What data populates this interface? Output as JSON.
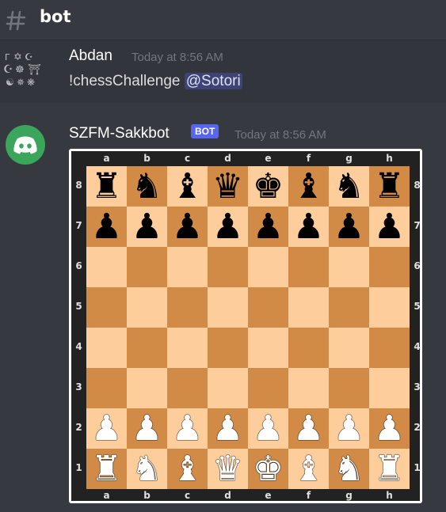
{
  "channel": {
    "name": "bot"
  },
  "messages": [
    {
      "username": "Abdan",
      "timestamp": "Today at 8:56 AM",
      "text": "!chessChallenge",
      "mention": "@Sotori"
    },
    {
      "username": "SZFM-Sakkbot",
      "badge": "BOT",
      "timestamp": "Today at 8:56 AM"
    }
  ],
  "board": {
    "files": [
      "a",
      "b",
      "c",
      "d",
      "e",
      "f",
      "g",
      "h"
    ],
    "ranks": [
      "8",
      "7",
      "6",
      "5",
      "4",
      "3",
      "2",
      "1"
    ],
    "position": [
      [
        "bR",
        "bN",
        "bB",
        "bQ",
        "bK",
        "bB",
        "bN",
        "bR"
      ],
      [
        "bP",
        "bP",
        "bP",
        "bP",
        "bP",
        "bP",
        "bP",
        "bP"
      ],
      [
        "",
        "",
        "",
        "",
        "",
        "",
        "",
        ""
      ],
      [
        "",
        "",
        "",
        "",
        "",
        "",
        "",
        ""
      ],
      [
        "",
        "",
        "",
        "",
        "",
        "",
        "",
        ""
      ],
      [
        "",
        "",
        "",
        "",
        "",
        "",
        "",
        ""
      ],
      [
        "wP",
        "wP",
        "wP",
        "wP",
        "wP",
        "wP",
        "wP",
        "wP"
      ],
      [
        "wR",
        "wN",
        "wB",
        "wQ",
        "wK",
        "wB",
        "wN",
        "wR"
      ]
    ],
    "light_color": "#fdcd9c",
    "dark_color": "#d18b47"
  },
  "colors": {
    "background": "#36393f",
    "bot_badge": "#5865f2",
    "bot_avatar": "#3ba55c",
    "mention_bg": "#4a4f87"
  }
}
